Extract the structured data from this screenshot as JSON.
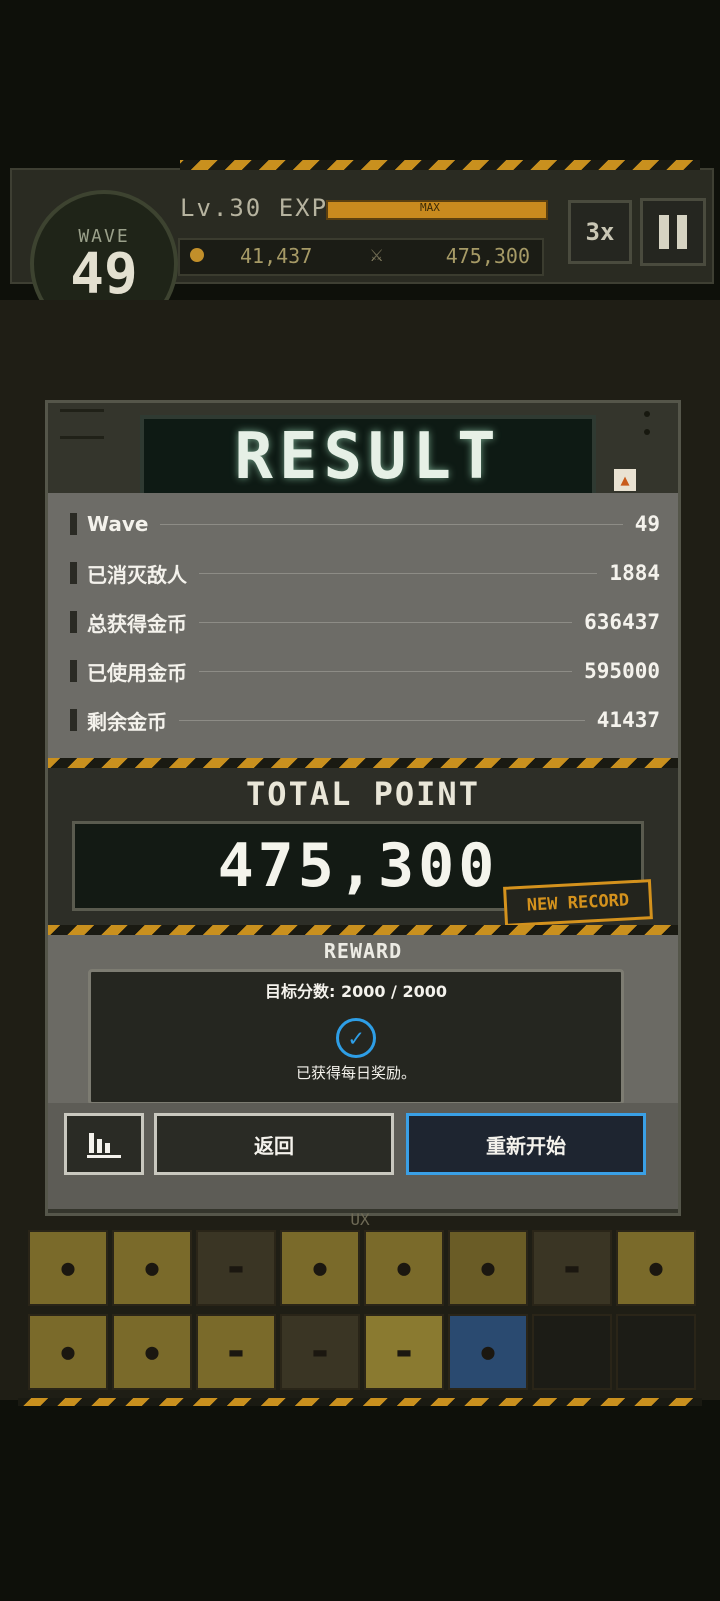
{
  "hud": {
    "wave_label": "WAVE",
    "wave_number": "49",
    "level_text": "Lv.30 EXP",
    "exp_max_label": "MAX",
    "coins": "41,437",
    "score": "475,300",
    "speed_label": "3x"
  },
  "result": {
    "title": "RESULT",
    "stats": [
      {
        "label": "Wave",
        "value": "49"
      },
      {
        "label": "已消灭敌人",
        "value": "1884"
      },
      {
        "label": "总获得金币",
        "value": "636437"
      },
      {
        "label": "已使用金币",
        "value": "595000"
      },
      {
        "label": "剩余金币",
        "value": "41437"
      }
    ],
    "total_title": "TOTAL POINT",
    "total_value": "475,300",
    "new_record": "NEW RECORD",
    "reward_title": "REWARD",
    "reward_target": "目标分数: 2000 / 2000",
    "reward_message": "已获得每日奖励。",
    "back_label": "返回",
    "restart_label": "重新开始"
  },
  "inventory": {
    "label": "UX"
  },
  "colors": {
    "accent_orange": "#c9901e",
    "accent_blue": "#3aa0e6"
  }
}
